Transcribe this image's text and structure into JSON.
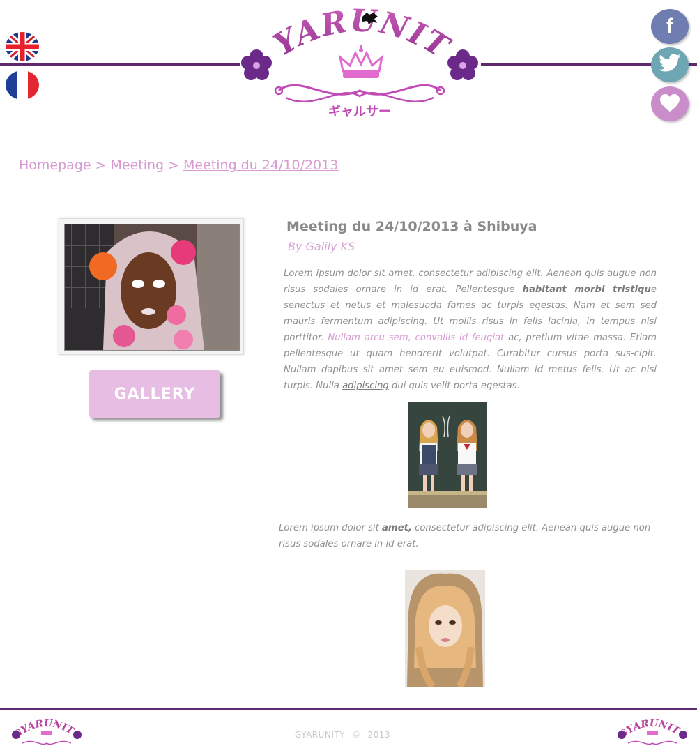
{
  "header": {
    "logo_text": "GYARUNITY",
    "logo_subtitle": "ギャルサー",
    "languages": [
      {
        "name": "english-flag"
      },
      {
        "name": "french-flag"
      }
    ],
    "social": [
      {
        "name": "facebook",
        "glyph": "f"
      },
      {
        "name": "twitter",
        "glyph": "🐦"
      },
      {
        "name": "heart",
        "glyph": "♥"
      }
    ]
  },
  "breadcrumb": {
    "home": "Homepage",
    "separator": ">",
    "section": "Meeting",
    "current": "Meeting du 24/10/2013"
  },
  "sidebar": {
    "gallery_label": "GALLERY"
  },
  "article": {
    "title": "Meeting du 24/10/2013 à Shibuya",
    "author": "By Galily KS",
    "p1": {
      "t1": "Lorem ipsum dolor sit amet, consectetur adipiscing elit. Aenean quis augue non risus sodales ornare in id erat. Pellentesque ",
      "bold": "habitant morbi tristiqu",
      "t2": "e senectus et netus et malesuada fames ac turpis egestas. Nam et sem sed mauris fermentum adipiscing. Ut mollis risus in felis lacinia, in tempus nisi porttitor. ",
      "link": "Nullam arcu sem, convallis id feugiat",
      "t3": " ac, pretium vitae massa. Etiam pellentesque ut quam hendrerit volutpat. Curabitur cursus porta sus-cipit. Nullam dapibus sit amet sem eu euismod. Nullam id metus felis. Ut ac nisi turpis. Nulla ",
      "underline": "adipiscing",
      "t4": " dui quis velit porta egestas."
    },
    "p2": {
      "t1": "Lorem ipsum dolor sit ",
      "bold": "amet,",
      "t2": " consectetur adipiscing elit. Aenean quis augue non risus sodales ornare in id erat."
    }
  },
  "footer": {
    "brand": "GYARUNITY",
    "copyright_symbol": "©",
    "year": "2013"
  },
  "colors": {
    "accent_purple": "#5e2a6b",
    "pink": "#d79ad1",
    "button_pink": "#e7bde3",
    "text_gray": "#8f8f8f"
  }
}
